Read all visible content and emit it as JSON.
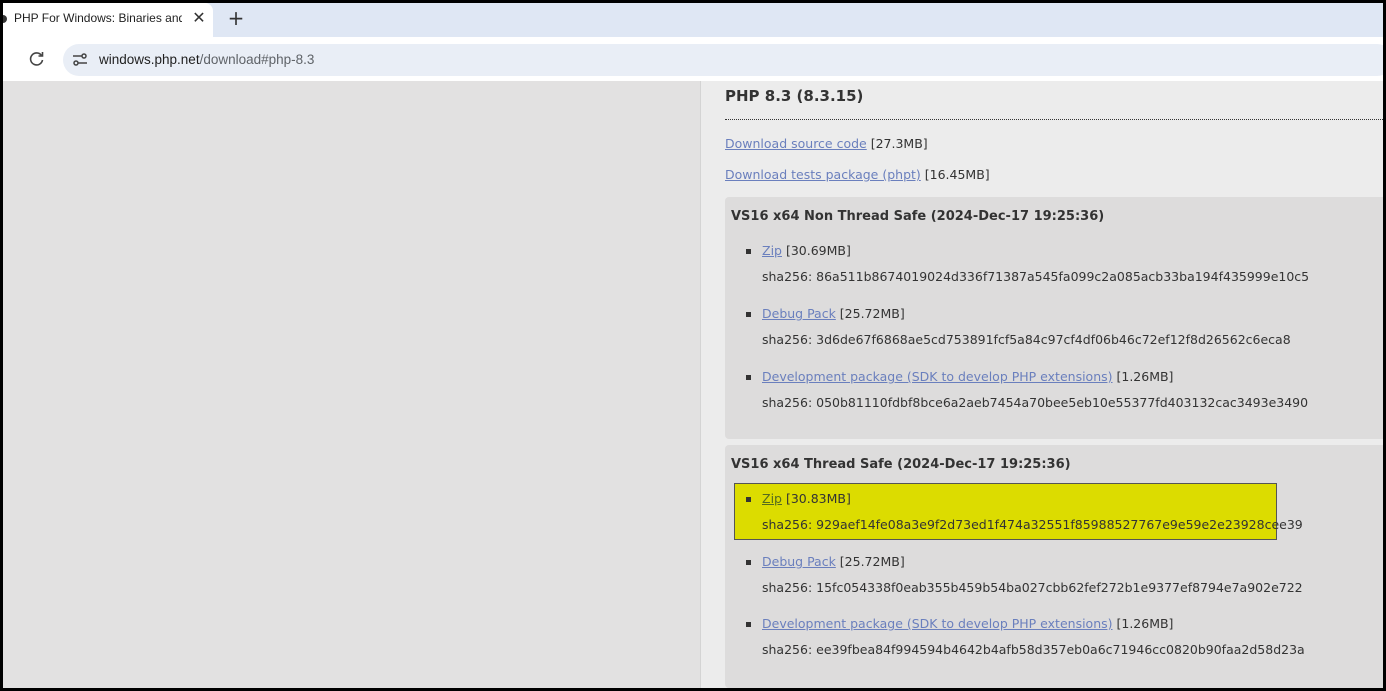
{
  "browser": {
    "tab_title": "PHP For Windows: Binaries and",
    "tab_close": "✕",
    "new_tab": "+",
    "url_domain": "windows.php.net",
    "url_path": "/download#php-8.3"
  },
  "main": {
    "heading": "PHP 8.3 (8.3.15)",
    "source_link": "Download source code",
    "source_size": " [27.3MB]",
    "tests_link": "Download tests package (phpt)",
    "tests_size": " [16.45MB]",
    "builds": [
      {
        "title": "VS16 x64 Non Thread Safe (2024-Dec-17 19:25:36)",
        "items": [
          {
            "link": "Zip",
            "size": " [30.69MB]",
            "sha": "sha256: 86a511b8674019024d336f71387a545fa099c2a085acb33ba194f435999e10c5"
          },
          {
            "link": "Debug Pack",
            "size": " [25.72MB]",
            "sha": "sha256: 3d6de67f6868ae5cd753891fcf5a84c97cf4df06b46c72ef12f8d26562c6eca8"
          },
          {
            "link": "Development package (SDK to develop PHP extensions)",
            "size": " [1.26MB]",
            "sha": "sha256: 050b81110fdbf8bce6a2aeb7454a70bee5eb10e55377fd403132cac3493e3490"
          }
        ]
      },
      {
        "title": "VS16 x64 Thread Safe (2024-Dec-17 19:25:36)",
        "items": [
          {
            "link": "Zip",
            "size": " [30.83MB]",
            "sha": "sha256: 929aef14fe08a3e9f2d73ed1f474a32551f85988527767e9e59e2e23928cee39"
          },
          {
            "link": "Debug Pack",
            "size": " [25.72MB]",
            "sha": "sha256: 15fc054338f0eab355b459b54ba027cbb62fef272b1e9377ef8794e7a902e722"
          },
          {
            "link": "Development package (SDK to develop PHP extensions)",
            "size": " [1.26MB]",
            "sha": "sha256: ee39fbea84f994594b4642b4afb58d357eb0a6c71946cc0820b90faa2d58d23a"
          }
        ]
      }
    ]
  },
  "colors": {
    "highlight": "#dcdc00",
    "link": "#6a7fbd",
    "panel": "#dddcdc"
  }
}
